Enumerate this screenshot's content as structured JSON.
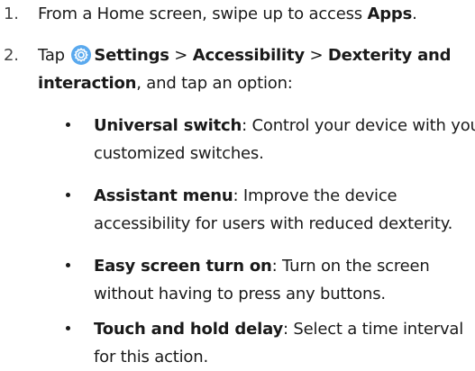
{
  "steps": [
    {
      "number": "1.",
      "pre": "From a Home screen, swipe up to access ",
      "bold": "Apps",
      "post": "."
    },
    {
      "number": "2.",
      "tap": "Tap",
      "path_settings": "Settings",
      "sep1": " > ",
      "path_accessibility": "Accessibility",
      "sep2": " > ",
      "path_dexterity_a": "Dexterity and",
      "path_dexterity_b": "interaction",
      "tail": ", and tap an option:",
      "icon": "settings-gear-icon"
    }
  ],
  "options": [
    {
      "term": "Universal switch",
      "line1": ": Control your device with your",
      "line2": "customized switches."
    },
    {
      "term": "Assistant menu",
      "line1": ": Improve the device",
      "line2": "accessibility for users with reduced dexterity."
    },
    {
      "term": "Easy screen turn on",
      "line1": ": Turn on the screen",
      "line2": "without having to press any buttons."
    },
    {
      "term": "Touch and hold delay",
      "line1": ": Select a time interval",
      "line2": "for this action."
    }
  ],
  "colors": {
    "settings_icon_bg": "#5aa9ee",
    "text": "#1a1a1a"
  }
}
